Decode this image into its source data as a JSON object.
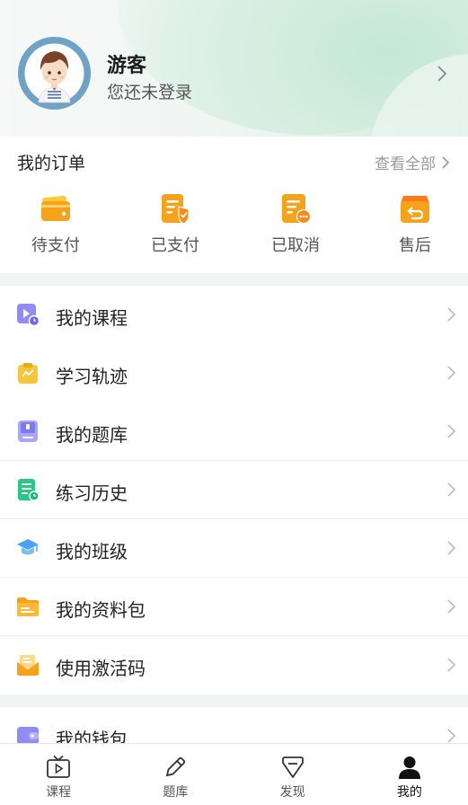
{
  "profile": {
    "name": "游客",
    "subtitle": "您还未登录"
  },
  "orders": {
    "title": "我的订单",
    "view_all": "查看全部",
    "items": [
      {
        "label": "待支付",
        "icon": "wallet-icon"
      },
      {
        "label": "已支付",
        "icon": "paid-document-icon"
      },
      {
        "label": "已取消",
        "icon": "cancelled-document-icon"
      },
      {
        "label": "售后",
        "icon": "return-box-icon"
      }
    ]
  },
  "menu": {
    "items": [
      {
        "label": "我的课程",
        "icon": "course-video-icon"
      },
      {
        "label": "学习轨迹",
        "icon": "learning-trend-icon"
      },
      {
        "label": "我的题库",
        "icon": "question-bank-icon"
      },
      {
        "label": "练习历史",
        "icon": "practice-history-icon"
      },
      {
        "label": "我的班级",
        "icon": "graduation-cap-icon"
      },
      {
        "label": "我的资料包",
        "icon": "folder-icon"
      },
      {
        "label": "使用激活码",
        "icon": "activation-envelope-icon"
      }
    ],
    "items2": [
      {
        "label": "我的钱包",
        "icon": "wallet-purple-icon"
      }
    ]
  },
  "tabbar": {
    "tabs": [
      {
        "label": "课程",
        "icon": "tv-icon",
        "active": false
      },
      {
        "label": "题库",
        "icon": "pencil-icon",
        "active": false
      },
      {
        "label": "发现",
        "icon": "discover-icon",
        "active": false
      },
      {
        "label": "我的",
        "icon": "person-icon",
        "active": true
      }
    ]
  },
  "colors": {
    "accent_orange": "#f7a21b",
    "header_green": "#cdebdc",
    "icon_purple": "#8f8cf4",
    "icon_yellow": "#f5c53a",
    "icon_green": "#2ac78a",
    "icon_blue": "#4aa3f0"
  }
}
